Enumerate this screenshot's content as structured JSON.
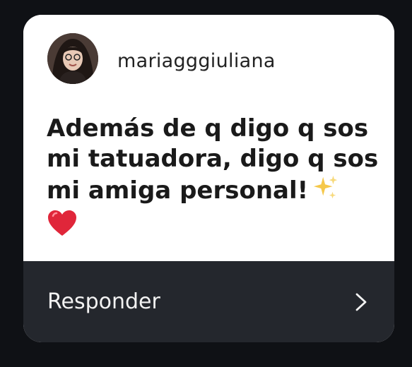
{
  "story_reply": {
    "username": "mariagggiuliana",
    "message_line1": "Además de q digo q sos",
    "message_line2": "mi tatuadora, digo q sos",
    "message_line3": "mi amiga personal!",
    "emoji_sparkles": "sparkles-icon",
    "emoji_heart": "red-heart-icon",
    "reply_label": "Responder",
    "reply_icon": "chevron-right-icon"
  },
  "colors": {
    "page_bg": "#0f1115",
    "card_bg": "#ffffff",
    "reply_bar_bg": "#24272d",
    "heart": "#e0263a",
    "sparkle": "#f5c84a"
  }
}
